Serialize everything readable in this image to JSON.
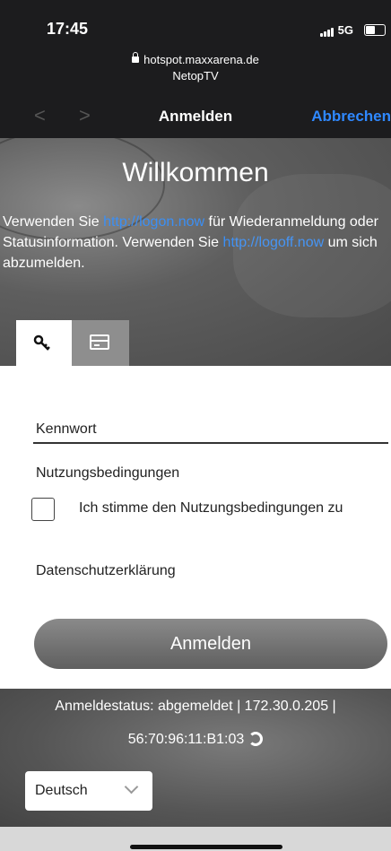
{
  "status_bar": {
    "time": "17:45",
    "network": "5G"
  },
  "browser": {
    "host": "hotspot.maxxarena.de",
    "page_name": "NetopTV",
    "nav_title": "Anmelden",
    "cancel_label": "Abbrechen",
    "back_symbol": "<",
    "forward_symbol": ">"
  },
  "hero": {
    "title": "Willkommen",
    "text_1": "Verwenden Sie ",
    "link_1": "http://logon.now",
    "text_2": " für Wiederanmeldung oder Statusinformation. Verwenden Sie ",
    "link_2": "http://logoff.now",
    "text_3": " um sich abzumelden."
  },
  "tabs": [
    {
      "icon": "key-icon"
    },
    {
      "icon": "credit-card-icon"
    }
  ],
  "form": {
    "password_label": "Kennwort",
    "terms_label": "Nutzungsbedingungen",
    "accept_terms_label": "Ich stimme den Nutzungsbedingungen zu",
    "accept_terms_checked": false,
    "privacy_label": "Datenschutzerklärung",
    "login_button": "Anmelden"
  },
  "footer": {
    "status_line_1": "Anmeldestatus: abgemeldet | 172.30.0.205 |",
    "mac_address": "56:70:96:11:B1:03",
    "refresh_icon": "refresh-icon",
    "language": "Deutsch"
  },
  "colors": {
    "link": "#3b8ff5",
    "cancel": "#2f88ff",
    "button": "#7a7a7a"
  }
}
